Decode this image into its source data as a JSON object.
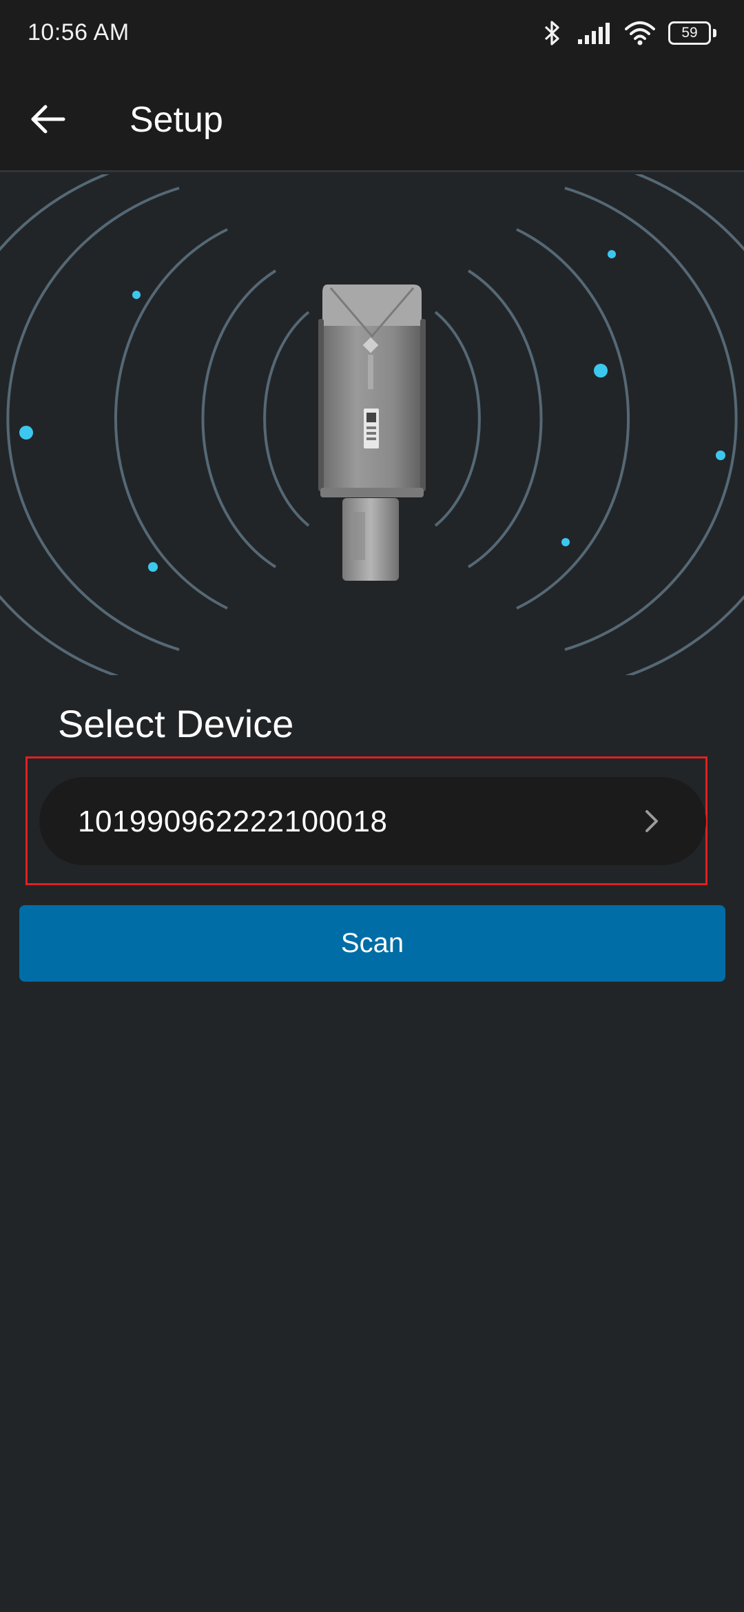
{
  "status_bar": {
    "time": "10:56 AM",
    "battery_level": "59",
    "icons": [
      "bluetooth-icon",
      "signal-icon",
      "wifi-icon",
      "battery-icon"
    ]
  },
  "app_bar": {
    "back_icon": "arrow-left-icon",
    "title": "Setup"
  },
  "hero": {
    "image": "wireless-datalogger-device-illustration"
  },
  "select_device": {
    "title": "Select Device",
    "device_id": "101990962222100018",
    "chevron_icon": "chevron-right-icon"
  },
  "actions": {
    "scan_label": "Scan"
  },
  "colors": {
    "background": "#222528",
    "bar_background": "#1c1c1c",
    "primary_button": "#006da6",
    "highlight_border": "#e02020",
    "ring_color": "#7fa0b4",
    "dot_color": "#3cc8ee"
  }
}
